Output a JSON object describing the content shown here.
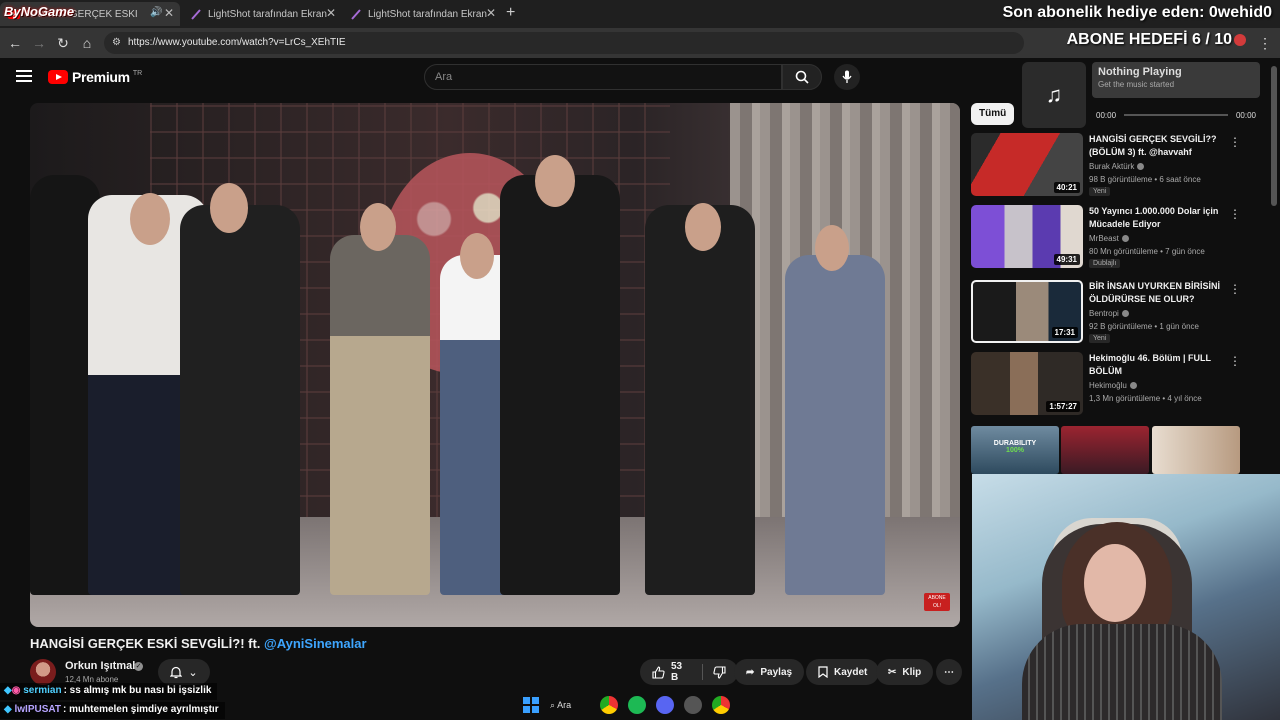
{
  "browser": {
    "tabs": [
      {
        "title": "HANGİSİ GERÇEK ESKİ",
        "active": true,
        "audio": true
      },
      {
        "title": "LightShot tarafından Ekran Gör",
        "active": false,
        "audio": false
      },
      {
        "title": "LightShot tarafından Ekran Gör",
        "active": false,
        "audio": false
      }
    ],
    "url": "https://www.youtube.com/watch?v=LrCs_XEhTIE"
  },
  "overlay": {
    "brand": "ByNoGame",
    "sub_gift": "Son abonelik hediye eden: 0wehid0",
    "goal": "ABONE HEDEFİ 6 / 10"
  },
  "youtube": {
    "logo": "Premium",
    "region": "TR",
    "search_placeholder": "Ara",
    "video": {
      "title_main": "HANGİSİ GERÇEK ESKİ SEVGİLİ?! ft.",
      "title_mention": "@AyniSinemalar",
      "badge": "ABONE OL!"
    },
    "channel": {
      "name": "Orkun Işıtmak",
      "subs": "12,4 Mn abone"
    },
    "actions": {
      "likes": "53 B",
      "share": "Paylaş",
      "save": "Kaydet",
      "clip": "Klip"
    },
    "chip": "Tümü",
    "recommendations": [
      {
        "title": "HANGİSİ GERÇEK SEVGİLİ?? (BÖLÜM 3) ft. @havvahf",
        "channel": "Burak Aktürk",
        "views": "98 B görüntüleme • 6 saat önce",
        "duration": "40:21",
        "tag": "Yeni"
      },
      {
        "title": "50 Yayıncı 1.000.000 Dolar için Mücadele Ediyor",
        "channel": "MrBeast",
        "views": "80 Mn görüntüleme • 7 gün önce",
        "duration": "49:31",
        "tag": "Dublajlı"
      },
      {
        "title": "BİR İNSAN UYURKEN BİRİSİNİ ÖLDÜRÜRSE NE OLUR?",
        "channel": "Bentropi",
        "views": "92 B görüntüleme • 1 gün önce",
        "duration": "17:31",
        "tag": "Yeni"
      },
      {
        "title": "Hekimoğlu 46. Bölüm | FULL BÖLÜM",
        "channel": "Hekimoğlu",
        "views": "1,3 Mn görüntüleme • 4 yıl önce",
        "duration": "1:57:27",
        "tag": ""
      }
    ]
  },
  "music": {
    "title": "Nothing Playing",
    "subtitle": "Get the music started",
    "start": "00:00",
    "end": "00:00"
  },
  "stream": {
    "durability": "DURABILITY",
    "durability_pct": "100%"
  },
  "chat": [
    {
      "user": "sermian",
      "message": ": ss almış mk bu nası bi işsizlik",
      "color": "#4fd0ff"
    },
    {
      "user": "lwIPUSAT",
      "message": ": muhtemelen şimdiye ayrılmıştır",
      "color": "#b7a4ff"
    }
  ],
  "taskbar": {
    "search": "Ara"
  }
}
